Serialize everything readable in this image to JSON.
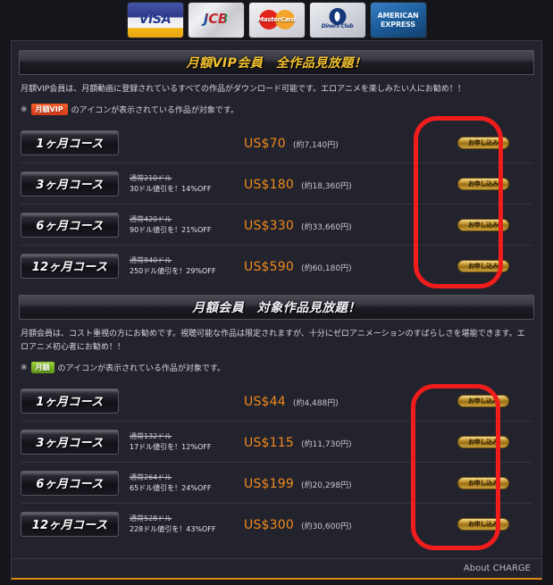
{
  "payment_logos": [
    {
      "name": "visa-logo",
      "label": "VISA"
    },
    {
      "name": "jcb-logo",
      "label": "JCB"
    },
    {
      "name": "mastercard-logo",
      "label": "MasterCard"
    },
    {
      "name": "diners-club-logo",
      "label": "Diners Club"
    },
    {
      "name": "american-express-logo",
      "label": "AMERICAN EXPRESS"
    }
  ],
  "sections": [
    {
      "header": "月額VIP会員　全作品見放題！",
      "description": "月額VIP会員は、月額動画に登録されているすべての作品がダウンロード可能です。エロアニメを楽しみたい人にお勧め！！",
      "note_prefix": "※",
      "note_badge": "月額VIP",
      "note_suffix": "のアイコンが表示されている作品が対象です。",
      "plans": [
        {
          "course": "1ヶ月コース",
          "regular": "",
          "off": "",
          "price": "US$70",
          "yen": "(約7,140円)",
          "order": "お申し込み"
        },
        {
          "course": "3ヶ月コース",
          "regular": "通常210ドル",
          "off": "30ドル値引を！14%OFF",
          "price": "US$180",
          "yen": "(約18,360円)",
          "order": "お申し込み"
        },
        {
          "course": "6ヶ月コース",
          "regular": "通常420ドル",
          "off": "90ドル値引を！21%OFF",
          "price": "US$330",
          "yen": "(約33,660円)",
          "order": "お申し込み"
        },
        {
          "course": "12ヶ月コース",
          "regular": "通常840ドル",
          "off": "250ドル値引を！29%OFF",
          "price": "US$590",
          "yen": "(約60,180円)",
          "order": "お申し込み"
        }
      ]
    },
    {
      "header": "月額会員　対象作品見放題！",
      "description": "月額会員は、コスト重視の方にお勧めです。視聴可能な作品は限定されますが、十分にゼロアニメーションのすばらしさを堪能できます。エロアニメ初心者にお勧め！！",
      "note_prefix": "※",
      "note_badge": "月額",
      "note_suffix": "のアイコンが表示されている作品が対象です。",
      "plans": [
        {
          "course": "1ヶ月コース",
          "regular": "",
          "off": "",
          "price": "US$44",
          "yen": "(約4,488円)",
          "order": "お申し込み"
        },
        {
          "course": "3ヶ月コース",
          "regular": "通常132ドル",
          "off": "17ドル値引を！12%OFF",
          "price": "US$115",
          "yen": "(約11,730円)",
          "order": "お申し込み"
        },
        {
          "course": "6ヶ月コース",
          "regular": "通常264ドル",
          "off": "65ドル値引を！24%OFF",
          "price": "US$199",
          "yen": "(約20,298円)",
          "order": "お申し込み"
        },
        {
          "course": "12ヶ月コース",
          "regular": "通常528ドル",
          "off": "228ドル値引を！43%OFF",
          "price": "US$300",
          "yen": "(約30,600円)",
          "order": "お申し込み"
        }
      ]
    }
  ],
  "footer": {
    "link": "About CHARGE"
  },
  "annotations": [
    {
      "name": "annotation-box-vip-order-column",
      "color": "#f11c1c"
    },
    {
      "name": "annotation-box-monthly-order-column",
      "color": "#f11c1c"
    }
  ],
  "colors": {
    "price": "#f08a1c",
    "title_gold": "#f2c231",
    "annotation": "#f11c1c",
    "panel_bg": "#23232e",
    "page_bg": "#15151c"
  }
}
